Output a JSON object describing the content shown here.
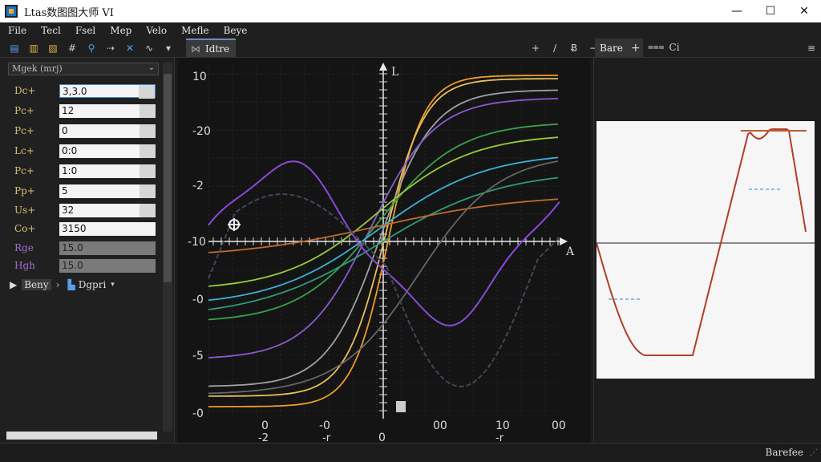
{
  "window": {
    "title": "Ltas数图图大师 VI"
  },
  "menu": [
    "File",
    "Tecl",
    "Fsel",
    "Mep",
    "Velo",
    "Mefle",
    "Beye"
  ],
  "toolbar": {
    "active_tab": "Idtre",
    "right_label": "Bare",
    "right_label2": "Ci"
  },
  "left": {
    "dropdown": "Mgek (mrj)",
    "props": [
      {
        "label": "Dc+",
        "value": "3,3.0",
        "color": "#d8c070"
      },
      {
        "label": "Pc+",
        "value": "12",
        "color": "#d8c070"
      },
      {
        "label": "Pc+",
        "value": "0",
        "color": "#d8c070"
      },
      {
        "label": "Lc+",
        "value": "0:0",
        "color": "#d8c070"
      },
      {
        "label": "Pc+",
        "value": "1:0",
        "color": "#d8c070"
      },
      {
        "label": "Pp+",
        "value": "5",
        "color": "#d8c070"
      },
      {
        "label": "Us+",
        "value": "32",
        "color": "#d8c070"
      },
      {
        "label": "Co+",
        "value": "3150",
        "color": "#d8c070"
      },
      {
        "label": "Rge",
        "value": "15.0",
        "color": "#a070d0"
      },
      {
        "label": "Hgh",
        "value": "15.0",
        "color": "#a070d0"
      }
    ],
    "bottom_a": "Beny",
    "bottom_b": "Dgpri"
  },
  "plot": {
    "y_ticks": [
      "10",
      "-20",
      "-2",
      "-10",
      "-0",
      "-5",
      "-0"
    ],
    "x_ticks_top": [
      "0",
      "-0",
      "0",
      "00",
      "10",
      "00"
    ],
    "x_ticks_bottom": [
      "-2",
      "-r",
      "0",
      "-r"
    ],
    "y_axis_label": "L",
    "x_axis_label": "A"
  },
  "status": {
    "text": "Barefee"
  }
}
